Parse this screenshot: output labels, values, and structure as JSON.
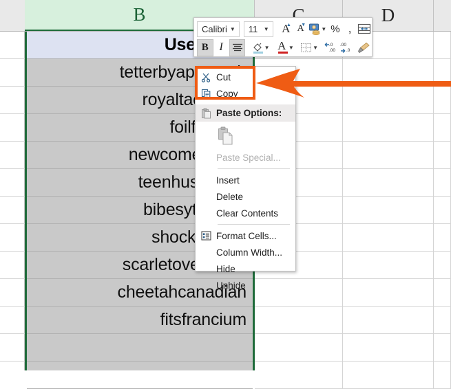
{
  "app": "Microsoft Excel",
  "grid": {
    "column_headers": [
      {
        "label": "B",
        "selected": true
      },
      {
        "label": "C",
        "selected": false
      },
      {
        "label": "D",
        "selected": false
      }
    ],
    "selected_column": "B",
    "header_cell": "Username",
    "column_b_values": [
      "tetterbyapproach",
      "royaltackletop",
      "foilfluorine",
      "newcomesauce",
      "teenhushroom",
      "bibesytropical",
      "shockingrain",
      "scarletoverdress",
      "cheetahcanadian",
      "fitsfrancium"
    ]
  },
  "mini_toolbar": {
    "font_name": "Calibri",
    "font_size": "11",
    "buttons": [
      {
        "name": "font-name-combo",
        "label": "Calibri"
      },
      {
        "name": "font-size-combo",
        "label": "11"
      },
      {
        "name": "increase-font-size",
        "label": "A"
      },
      {
        "name": "decrease-font-size",
        "label": "A"
      },
      {
        "name": "accounting-number-format",
        "label": ""
      },
      {
        "name": "percent-style",
        "label": "%"
      },
      {
        "name": "comma-style",
        "label": ","
      },
      {
        "name": "merge-and-center",
        "label": ""
      },
      {
        "name": "bold",
        "label": "B"
      },
      {
        "name": "italic",
        "label": "I"
      },
      {
        "name": "center-align",
        "label": ""
      },
      {
        "name": "fill-color",
        "label": ""
      },
      {
        "name": "font-color",
        "label": "A"
      },
      {
        "name": "borders",
        "label": ""
      },
      {
        "name": "decrease-decimal",
        "label": ".00"
      },
      {
        "name": "increase-decimal",
        "label": ".00"
      },
      {
        "name": "format-painter",
        "label": ""
      }
    ]
  },
  "context_menu": {
    "items": [
      {
        "label": "Cut",
        "icon": "scissors-icon",
        "state": "enabled",
        "accel": "t"
      },
      {
        "label": "Copy",
        "icon": "copy-icon",
        "state": "enabled",
        "accel": "C"
      },
      {
        "label": "Paste Options:",
        "icon": "paste-icon",
        "state": "header",
        "accel": ""
      },
      {
        "label": "Paste Special...",
        "icon": "",
        "state": "disabled",
        "accel": "S"
      },
      {
        "label": "Insert",
        "icon": "",
        "state": "enabled",
        "accel": "I"
      },
      {
        "label": "Delete",
        "icon": "",
        "state": "enabled",
        "accel": "D"
      },
      {
        "label": "Clear Contents",
        "icon": "",
        "state": "enabled",
        "accel": "n"
      },
      {
        "label": "Format Cells...",
        "icon": "format-cells-icon",
        "state": "enabled",
        "accel": "F"
      },
      {
        "label": "Column Width...",
        "icon": "",
        "state": "enabled",
        "accel": "W"
      },
      {
        "label": "Hide",
        "icon": "",
        "state": "enabled",
        "accel": "H"
      },
      {
        "label": "Unhide",
        "icon": "",
        "state": "enabled",
        "accel": "U"
      }
    ]
  },
  "annotation": {
    "highlight_color": "#ef5c14",
    "arrow_color": "#ef5c14",
    "highlighted_items": "Cut, Copy"
  },
  "colors": {
    "selection_green": "#1e6b3a",
    "header_green_fill": "#d7f0dd",
    "selected_cells_gray": "#c9c9c9",
    "header_row_blue": "#dde2f2",
    "accent_orange": "#ef5c14"
  }
}
